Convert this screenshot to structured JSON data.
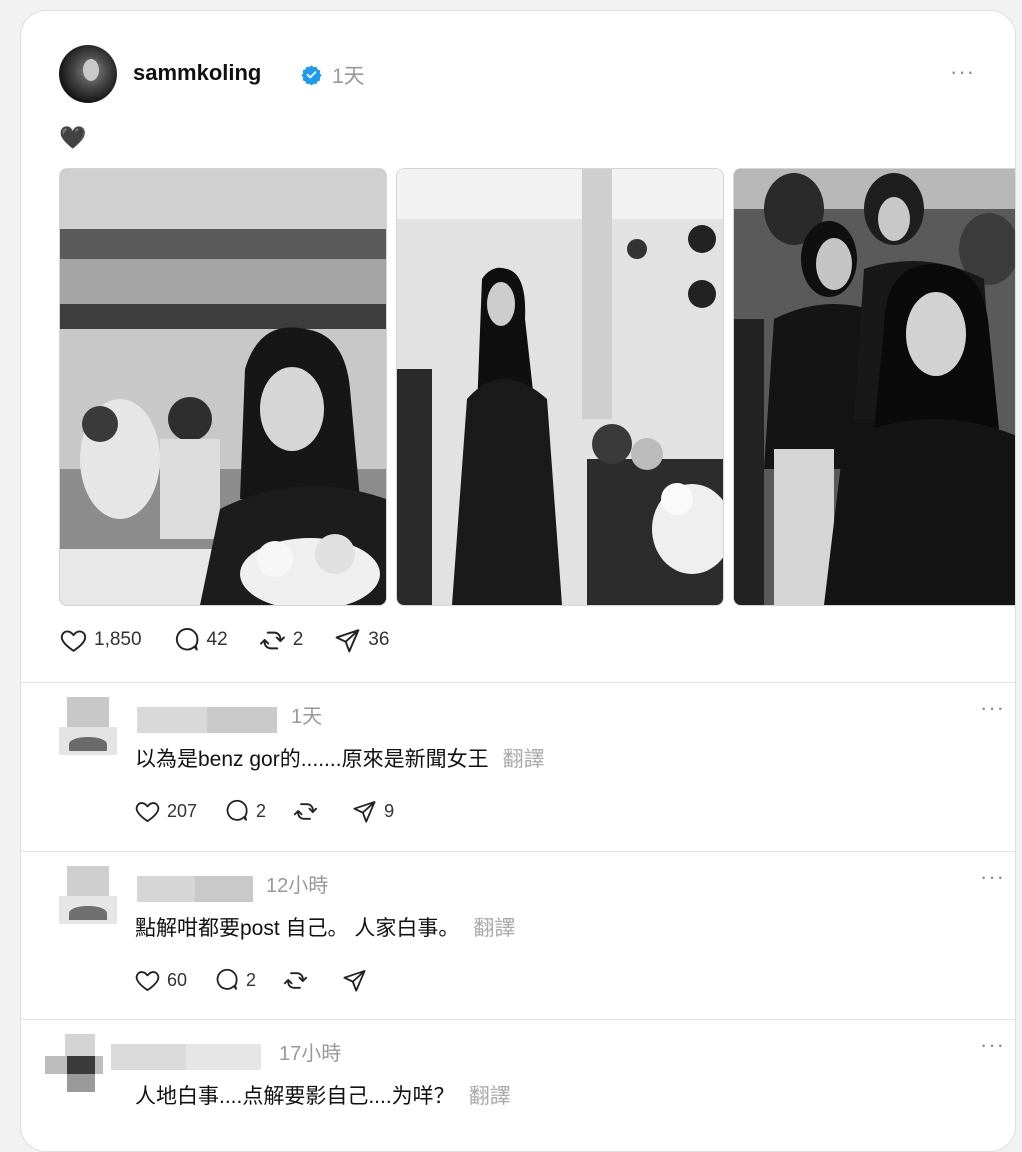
{
  "post": {
    "username": "sammkoling",
    "time": "1天",
    "caption": "🖤",
    "more_label": "···",
    "stats": {
      "likes": "1,850",
      "replies": "42",
      "reposts": "2",
      "shares": "36"
    },
    "images": [
      {
        "icon": "photo-woman-seated-flowers"
      },
      {
        "icon": "photo-woman-standing"
      },
      {
        "icon": "photo-woman-seated-crowd"
      }
    ]
  },
  "comments": [
    {
      "time": "1天",
      "text": "以為是benz gor的.......原來是新聞女王",
      "translate": "翻譯",
      "more_label": "···",
      "likes": "207",
      "replies": "2",
      "reposts": "",
      "shares": "9"
    },
    {
      "time": "12小時",
      "text": "點解咁都要post 自己。 人家白事。",
      "translate": "翻譯",
      "more_label": "···",
      "likes": "60",
      "replies": "2",
      "reposts": "",
      "shares": ""
    },
    {
      "time": "17小時",
      "text": "人地白事....点解要影自己....为咩？",
      "translate": "翻譯",
      "more_label": "···"
    }
  ],
  "colors": {
    "verified": "#1d9bf0",
    "muted_text": "#999999",
    "icon_stroke": "#222222"
  }
}
